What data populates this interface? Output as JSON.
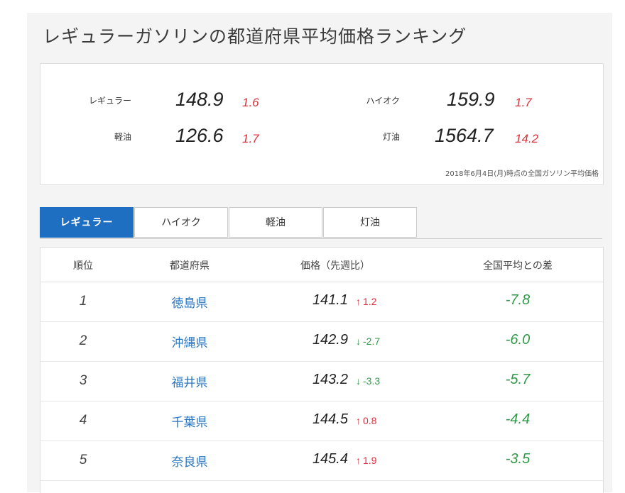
{
  "page": {
    "title": "レギュラーガソリンの都道府県平均価格ランキング"
  },
  "summary": {
    "items": [
      {
        "label": "レギュラー",
        "price": "148.9",
        "diff": "1.6"
      },
      {
        "label": "ハイオク",
        "price": "159.9",
        "diff": "1.7"
      },
      {
        "label": "軽油",
        "price": "126.6",
        "diff": "1.7"
      },
      {
        "label": "灯油",
        "price": "1564.7",
        "diff": "14.2"
      }
    ],
    "note": "2018年6月4日(月)時点の全国ガソリン平均価格"
  },
  "tabs": [
    {
      "label": "レギュラー",
      "active": true
    },
    {
      "label": "ハイオク",
      "active": false
    },
    {
      "label": "軽油",
      "active": false
    },
    {
      "label": "灯油",
      "active": false
    }
  ],
  "table": {
    "headers": [
      "順位",
      "都道府県",
      "価格（先週比）",
      "全国平均との差"
    ],
    "rows": [
      {
        "rank": "1",
        "prefecture": "徳島県",
        "price": "141.1",
        "direction": "up",
        "change": "1.2",
        "avg_diff": "-7.8"
      },
      {
        "rank": "2",
        "prefecture": "沖縄県",
        "price": "142.9",
        "direction": "down",
        "change": "-2.7",
        "avg_diff": "-6.0"
      },
      {
        "rank": "3",
        "prefecture": "福井県",
        "price": "143.2",
        "direction": "down",
        "change": "-3.3",
        "avg_diff": "-5.7"
      },
      {
        "rank": "4",
        "prefecture": "千葉県",
        "price": "144.5",
        "direction": "up",
        "change": "0.8",
        "avg_diff": "-4.4"
      },
      {
        "rank": "5",
        "prefecture": "奈良県",
        "price": "145.4",
        "direction": "up",
        "change": "1.9",
        "avg_diff": "-3.5"
      }
    ]
  },
  "icons": {
    "up": "arrow-up-icon",
    "down": "arrow-down-icon"
  },
  "colors": {
    "accent": "#1e6fc1",
    "up": "#d9343f",
    "down": "#2f9a47",
    "link": "#2a76c0"
  }
}
